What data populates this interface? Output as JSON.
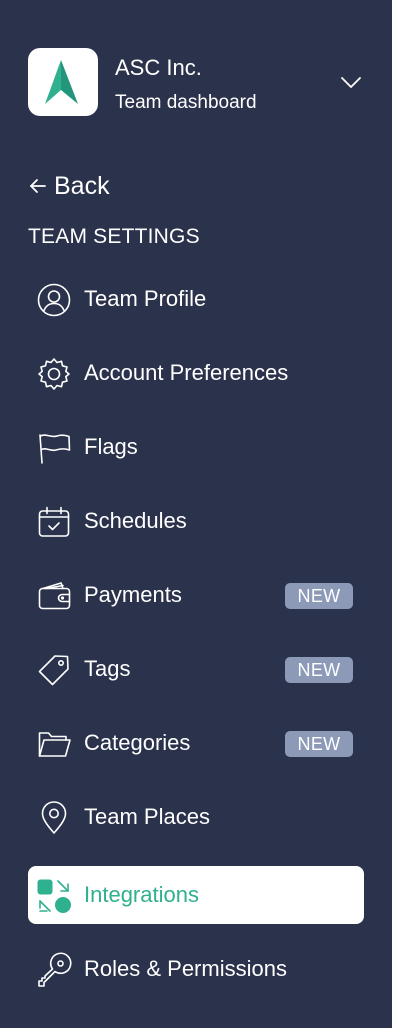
{
  "team": {
    "name": "ASC Inc.",
    "subtitle": "Team dashboard",
    "logo_color": "#2fb08e"
  },
  "back": {
    "label": "Back",
    "icon": "arrow-left-icon"
  },
  "section_title": "TEAM SETTINGS",
  "nav": {
    "items": [
      {
        "label": "Team Profile",
        "icon": "user-circle-icon",
        "badge": "",
        "active": false
      },
      {
        "label": "Account Preferences",
        "icon": "gear-icon",
        "badge": "",
        "active": false
      },
      {
        "label": "Flags",
        "icon": "flag-icon",
        "badge": "",
        "active": false
      },
      {
        "label": "Schedules",
        "icon": "calendar-check-icon",
        "badge": "",
        "active": false
      },
      {
        "label": "Payments",
        "icon": "wallet-icon",
        "badge": "NEW",
        "active": false
      },
      {
        "label": "Tags",
        "icon": "tag-icon",
        "badge": "NEW",
        "active": false
      },
      {
        "label": "Categories",
        "icon": "folder-icon",
        "badge": "NEW",
        "active": false
      },
      {
        "label": "Team Places",
        "icon": "map-pin-icon",
        "badge": "",
        "active": false
      },
      {
        "label": "Integrations",
        "icon": "integrations-icon",
        "badge": "",
        "active": true
      },
      {
        "label": "Roles & Permissions",
        "icon": "key-icon",
        "badge": "",
        "active": false
      }
    ]
  },
  "colors": {
    "sidebar_background": "#2b324b",
    "accent": "#2fb08e",
    "badge_background": "#8c9ab8",
    "text": "#ffffff"
  }
}
